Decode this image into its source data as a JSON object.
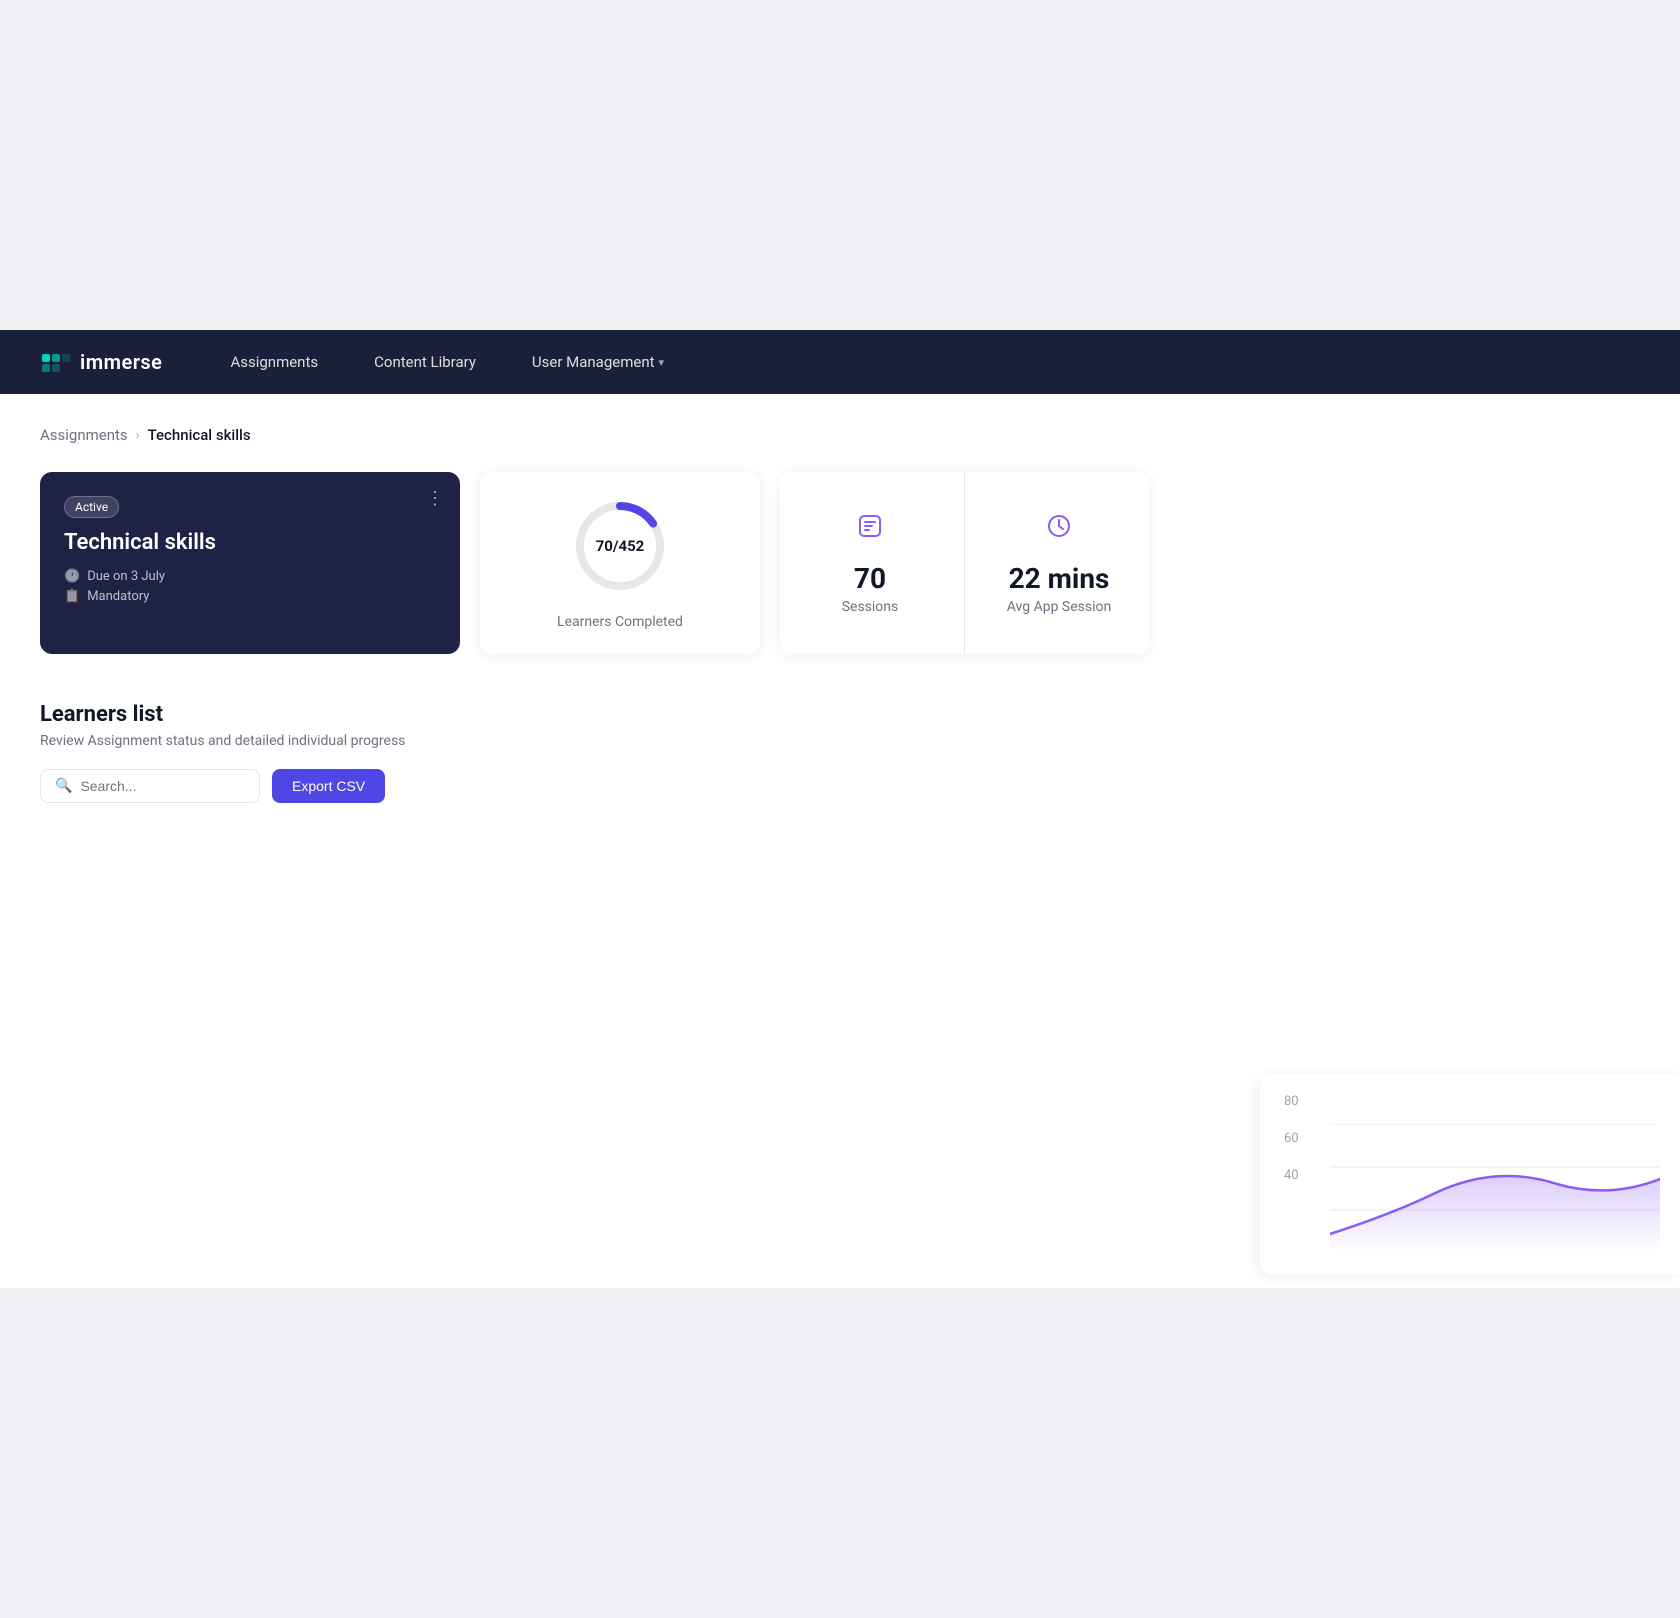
{
  "hero": {
    "circles": [
      {
        "id": "percent",
        "symbol": "%"
      },
      {
        "id": "trend",
        "symbol": "📈"
      },
      {
        "id": "coin",
        "symbol": "💲"
      },
      {
        "id": "up",
        "symbol": "↑"
      }
    ]
  },
  "navbar": {
    "logo_text": "immerse",
    "nav_items": [
      {
        "id": "assignments",
        "label": "Assignments",
        "has_dropdown": false
      },
      {
        "id": "content-library",
        "label": "Content Library",
        "has_dropdown": false
      },
      {
        "id": "user-management",
        "label": "User Management",
        "has_dropdown": true
      }
    ]
  },
  "breadcrumb": {
    "parent": "Assignments",
    "current": "Technical skills"
  },
  "assignment_card": {
    "status": "Active",
    "title": "Technical skills",
    "due_date": "Due on 3 July",
    "type": "Mandatory"
  },
  "stats": {
    "learners_completed": {
      "completed": 70,
      "total": 452,
      "label": "Learners Completed",
      "display": "70/452",
      "donut_percent": 15.5
    },
    "sessions": {
      "value": 70,
      "label": "Sessions"
    },
    "avg_session": {
      "value": "22 mins",
      "label": "Avg App Session"
    }
  },
  "learners_list": {
    "title": "Learners list",
    "subtitle": "Review Assignment status and detailed individual progress",
    "search_placeholder": "Search...",
    "export_button": "Export CSV"
  },
  "chart": {
    "y_labels": [
      "80",
      "60",
      "40"
    ]
  },
  "colors": {
    "navbar_bg": "#1a1f3a",
    "card_bg": "#1e2346",
    "accent": "#4f46e5",
    "donut_stroke": "#6366f1",
    "icon_purple": "#8b5cf6",
    "icon_clock": "#8b5cf6"
  }
}
